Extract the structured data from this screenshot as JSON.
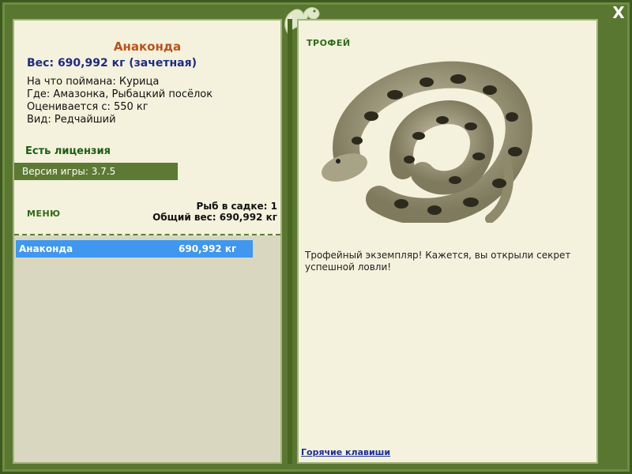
{
  "window": {
    "close_label": "X"
  },
  "fish": {
    "name": "Анаконда",
    "weight_line": "Вес: 690,992 кг (зачетная)",
    "bait": "На что поймана: Курица",
    "location": "Где: Амазонка, Рыбацкий посёлок",
    "valued_from": "Оценивается с: 550 кг",
    "rarity": "Вид: Редчайший"
  },
  "license": "Есть лицензия",
  "version": "Версия игры: 3.7.5",
  "menu_label": "МЕНЮ",
  "stats": {
    "fish_in_keepnet": "Рыб в садке: 1",
    "total_weight": "Общий вес: 690,992 кг"
  },
  "catch_list": [
    {
      "name": "Анаконда",
      "weight": "690,992 кг"
    }
  ],
  "trophy": {
    "label": "ТРОФЕЙ",
    "text": "Трофейный экземпляр! Кажется, вы открыли секрет успешной ловли!"
  },
  "hotkeys_link": "Горячие клавиши",
  "colors": {
    "frame": "#5a7732",
    "panel": "#f4f2dc",
    "title": "#c0501c",
    "weight": "#1d2a87",
    "selected_row": "#3f97ef"
  },
  "icons": [
    "lizard-logo-icon",
    "close-icon"
  ]
}
